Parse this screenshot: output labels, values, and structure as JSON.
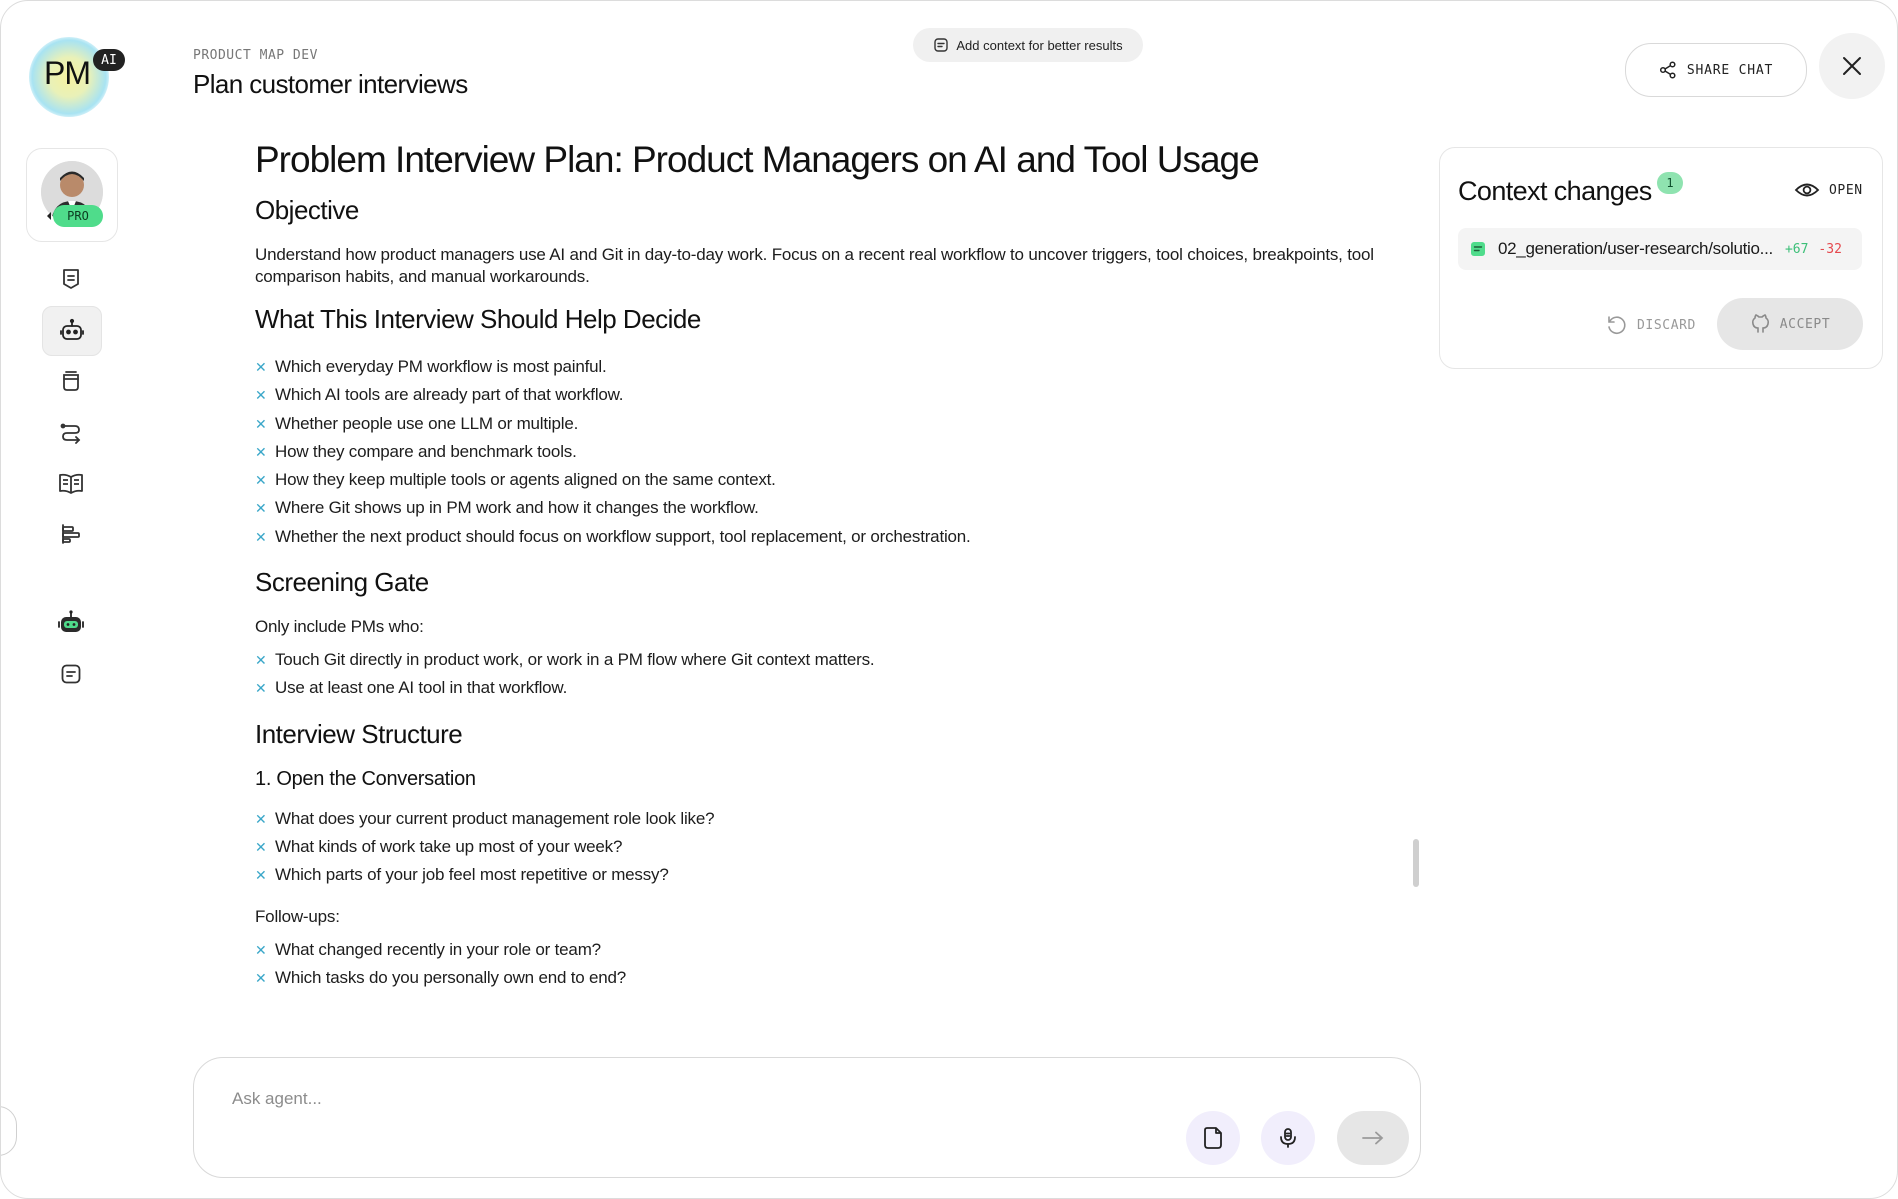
{
  "logo": {
    "text": "PM",
    "badge": "AI"
  },
  "profile": {
    "badge": "PRO"
  },
  "header": {
    "breadcrumb": "PRODUCT MAP DEV",
    "title": "Plan customer interviews",
    "context_pill": "Add context for better results",
    "share_label": "SHARE CHAT"
  },
  "document": {
    "title": "Problem Interview Plan: Product Managers on AI and Tool Usage",
    "objective_heading": "Objective",
    "objective_text": "Understand how product managers use AI and Git in day-to-day work. Focus on a recent real workflow to uncover triggers, tool choices, breakpoints, tool comparison habits, and manual workarounds.",
    "decide_heading": "What This Interview Should Help Decide",
    "decide_items": [
      "Which everyday PM workflow is most painful.",
      "Which AI tools are already part of that workflow.",
      "Whether people use one LLM or multiple.",
      "How they compare and benchmark tools.",
      "How they keep multiple tools or agents aligned on the same context.",
      "Where Git shows up in PM work and how it changes the workflow.",
      "Whether the next product should focus on workflow support, tool replacement, or orchestration."
    ],
    "screening_heading": "Screening Gate",
    "screening_intro": "Only include PMs who:",
    "screening_items": [
      "Touch Git directly in product work, or work in a PM flow where Git context matters.",
      "Use at least one AI tool in that workflow."
    ],
    "structure_heading": "Interview Structure",
    "section1_heading": "1. Open the Conversation",
    "section1_items": [
      "What does your current product management role look like?",
      "What kinds of work take up most of your week?",
      "Which parts of your job feel most repetitive or messy?"
    ],
    "followups_label": "Follow-ups:",
    "followup_items": [
      "What changed recently in your role or team?",
      "Which tasks do you personally own end to end?"
    ]
  },
  "context_panel": {
    "title": "Context changes",
    "count": "1",
    "open_label": "OPEN",
    "file_name": "02_generation/user-research/solutio...",
    "additions": "+67",
    "deletions": "-32",
    "discard_label": "DISCARD",
    "accept_label": "ACCEPT"
  },
  "composer": {
    "placeholder": "Ask agent..."
  },
  "colors": {
    "accent_green": "#4fdc8b",
    "bullet_blue": "#3aa7c9",
    "add_green": "#3cbf78",
    "del_red": "#e5484d"
  }
}
